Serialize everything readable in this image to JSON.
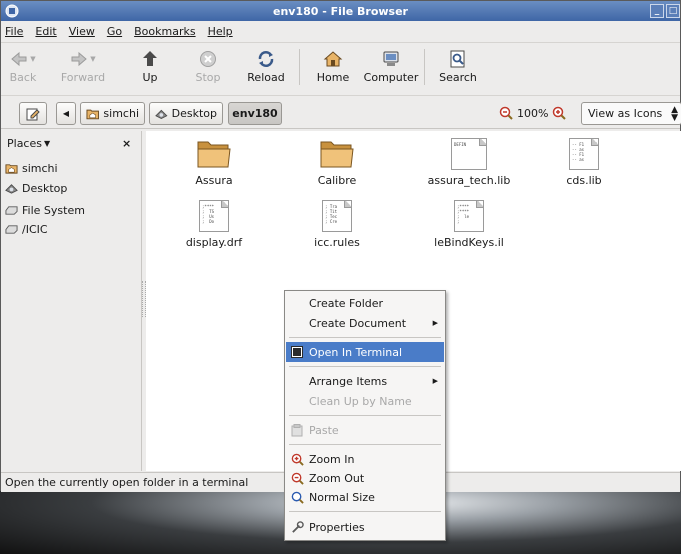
{
  "window": {
    "title": "env180 - File Browser"
  },
  "menubar": {
    "items": [
      "File",
      "Edit",
      "View",
      "Go",
      "Bookmarks",
      "Help"
    ]
  },
  "toolbar": {
    "back": "Back",
    "forward": "Forward",
    "up": "Up",
    "stop": "Stop",
    "reload": "Reload",
    "home": "Home",
    "computer": "Computer",
    "search": "Search"
  },
  "location": {
    "crumbs": [
      "simchi",
      "Desktop",
      "env180"
    ],
    "zoom": "100%",
    "view_mode": "View as Icons"
  },
  "sidebar": {
    "header": "Places",
    "items": [
      "simchi",
      "Desktop",
      "File System",
      "/ICIC"
    ]
  },
  "files": [
    {
      "name": "Assura",
      "type": "folder"
    },
    {
      "name": "Calibre",
      "type": "folder"
    },
    {
      "name": "assura_tech.lib",
      "type": "file",
      "preview": "DEFIN"
    },
    {
      "name": "cds.lib",
      "type": "file",
      "preview": "-- F1\n-- as\n-- F1\n-- as"
    },
    {
      "name": "display.drf",
      "type": "file",
      "preview": ";****\n;  TS\n;  Us\n;  Do"
    },
    {
      "name": "icc.rules",
      "type": "file",
      "preview": "; Tra\n; Tit\n; Tec\n; Cre"
    },
    {
      "name": "leBindKeys.il",
      "type": "file",
      "preview": ";****\n;****\n;  le\n;"
    }
  ],
  "status": {
    "text": "Open the currently open folder in a terminal"
  },
  "context_menu": {
    "create_folder": "Create Folder",
    "create_document": "Create Document",
    "open_terminal": "Open In Terminal",
    "arrange_items": "Arrange Items",
    "clean_up": "Clean Up by Name",
    "paste": "Paste",
    "zoom_in": "Zoom In",
    "zoom_out": "Zoom Out",
    "normal_size": "Normal Size",
    "properties": "Properties"
  },
  "colors": {
    "titlebar": "#4f76b2",
    "highlight": "#4a7cc8",
    "folder": "#e8b468"
  }
}
